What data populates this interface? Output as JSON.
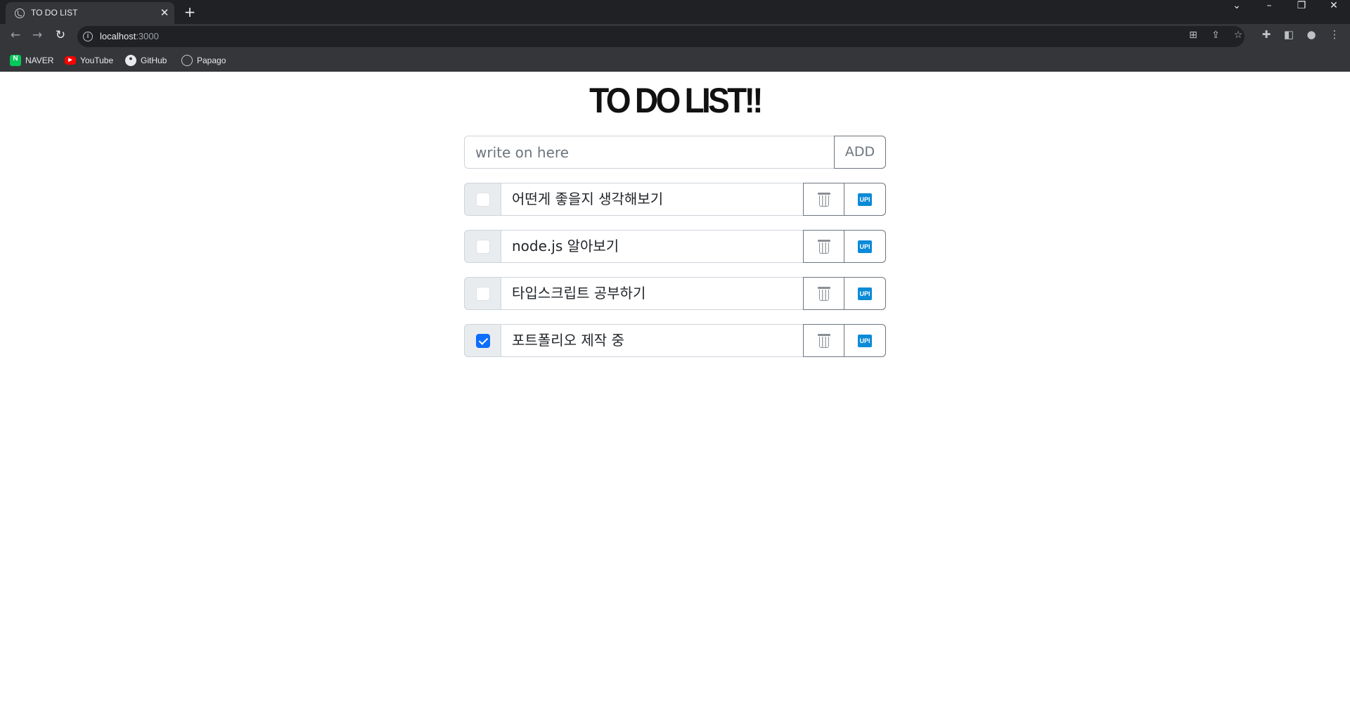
{
  "browser": {
    "tab_title": "TO DO LIST",
    "tab_close": "✕",
    "new_tab": "+",
    "url_host": "localhost",
    "url_port": ":3000",
    "bookmarks": [
      {
        "label": "NAVER",
        "icon": "naver-icon"
      },
      {
        "label": "YouTube",
        "icon": "youtube-icon"
      },
      {
        "label": "GitHub",
        "icon": "github-icon"
      },
      {
        "label": "Papago",
        "icon": "papago-icon"
      }
    ]
  },
  "page": {
    "title": "TO DO LIST!!",
    "input_placeholder": "write on here",
    "add_label": "ADD"
  },
  "todos": [
    {
      "text": "어떤게 좋을지 생각해보기",
      "checked": false,
      "update_label": "UPI"
    },
    {
      "text": "node.js 알아보기",
      "checked": false,
      "update_label": "UPI"
    },
    {
      "text": "타입스크립트 공부하기",
      "checked": false,
      "update_label": "UPI"
    },
    {
      "text": "포트폴리오 제작 중",
      "checked": true,
      "update_label": "UPI"
    }
  ],
  "colors": {
    "checkbox_checked": "#0d6efd",
    "update_icon": "#0b8ad8",
    "chrome_dark": "#202124",
    "chrome_toolbar": "#35363a"
  }
}
